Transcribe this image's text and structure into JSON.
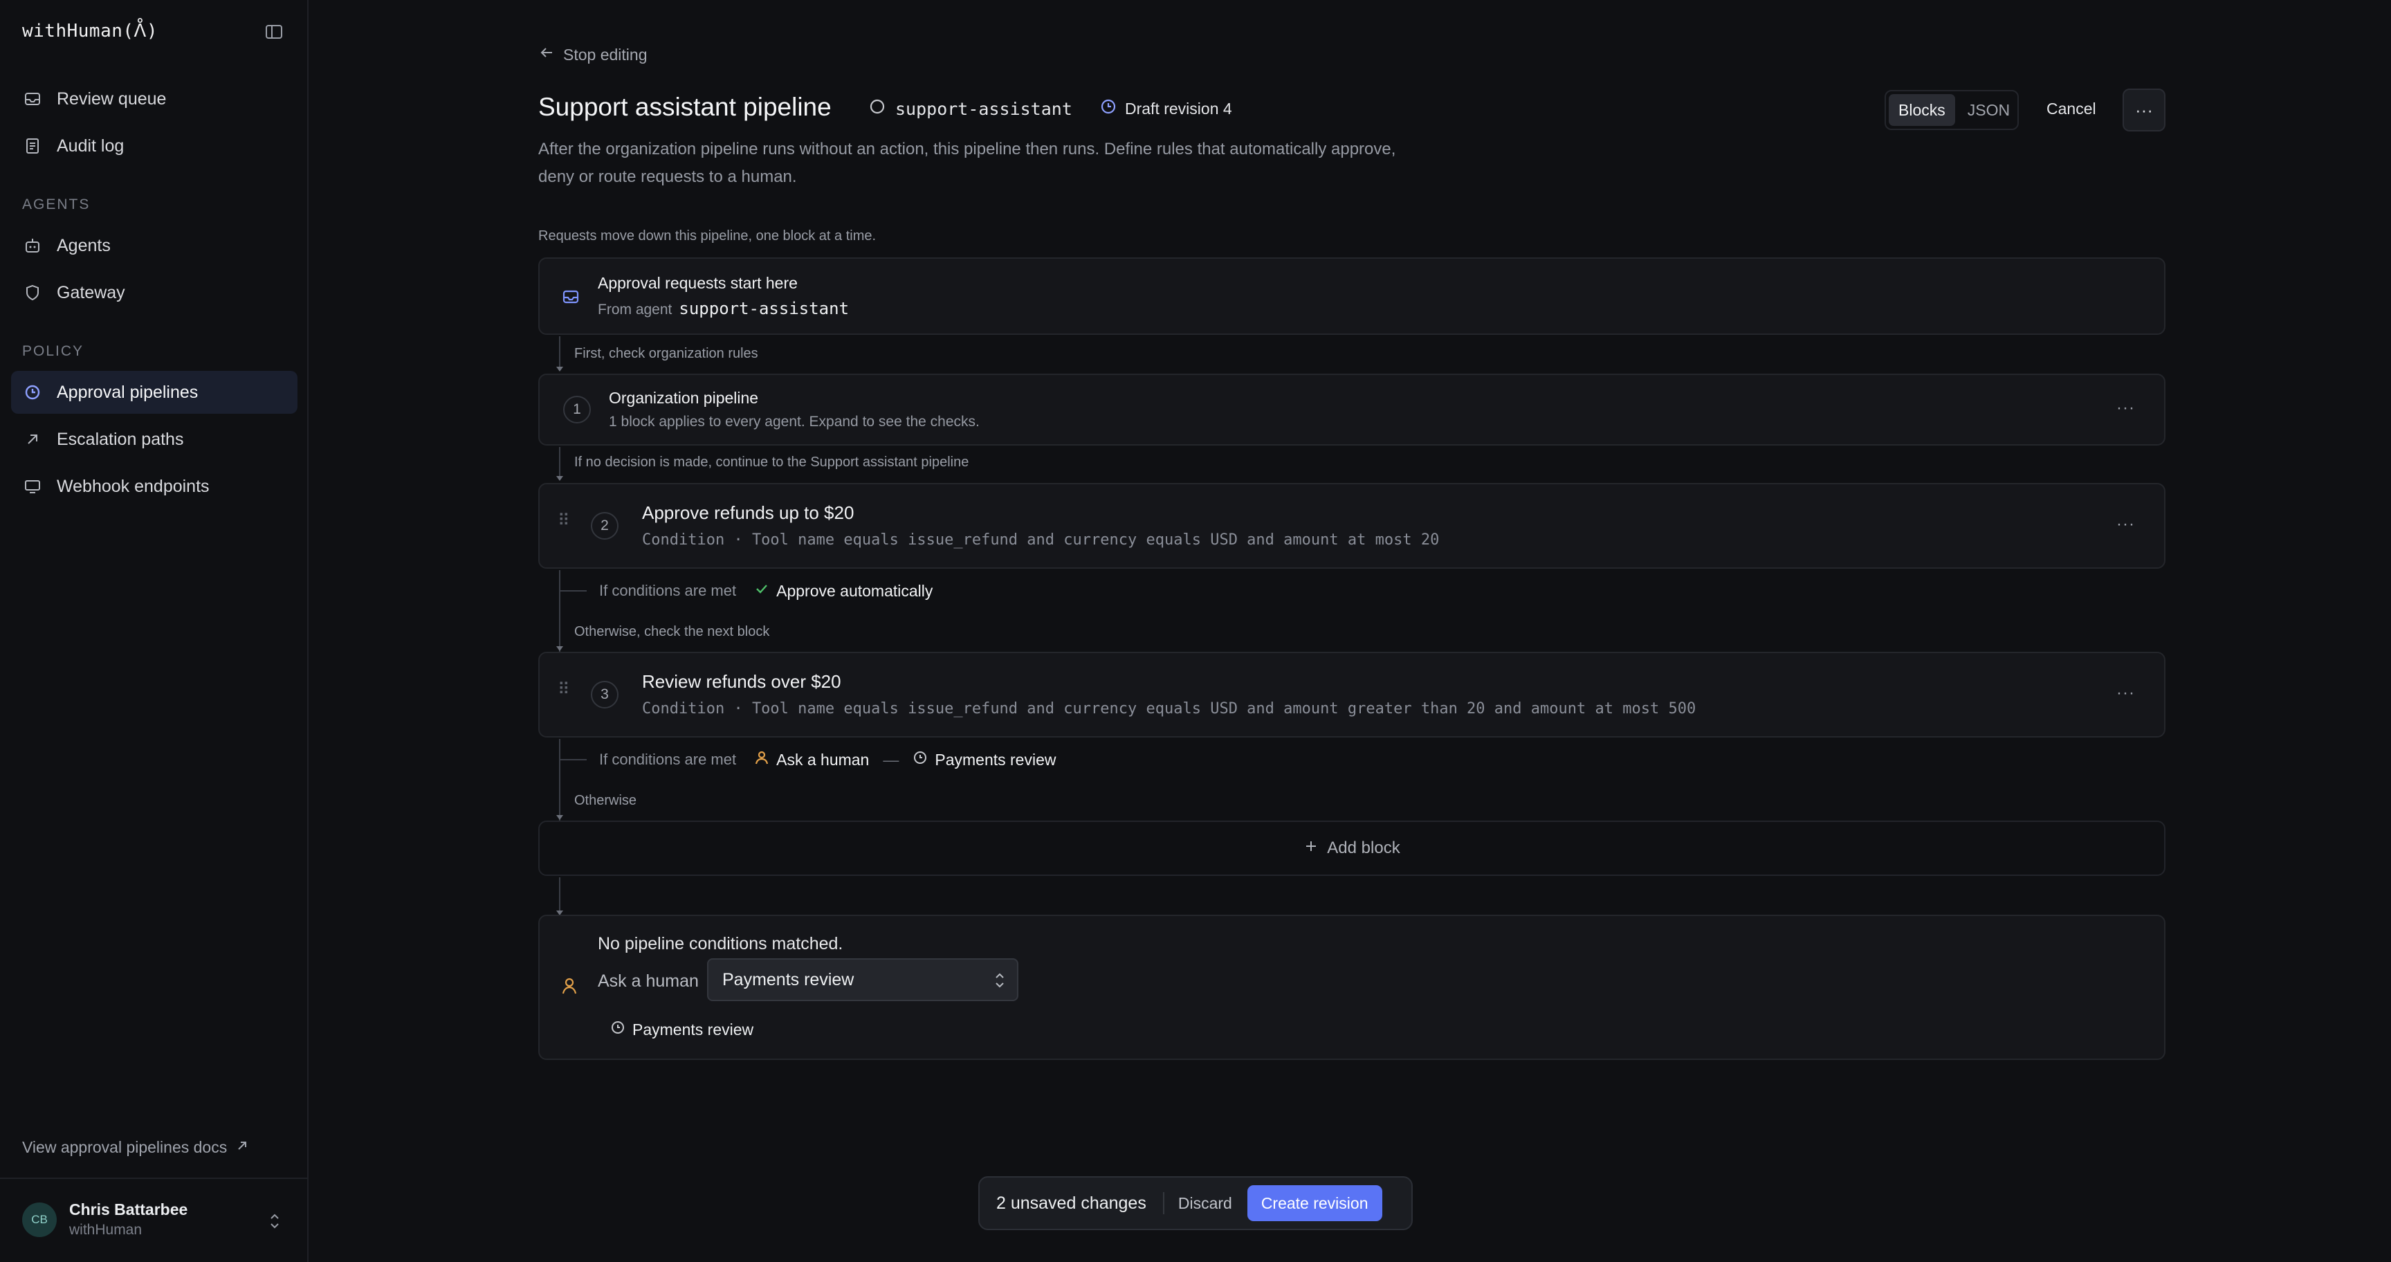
{
  "sidebar": {
    "brand": "withHuman(ᐰ)",
    "top_items": [
      {
        "label": "Review queue",
        "icon": "inbox-icon"
      },
      {
        "label": "Audit log",
        "icon": "document-icon"
      }
    ],
    "agents_label": "AGENTS",
    "agent_items": [
      {
        "label": "Agents",
        "icon": "bot-icon"
      },
      {
        "label": "Gateway",
        "icon": "shield-icon"
      }
    ],
    "policy_label": "POLICY",
    "policy_items": [
      {
        "label": "Approval pipelines",
        "icon": "pipeline-icon",
        "active": true
      },
      {
        "label": "Escalation paths",
        "icon": "arrow-up-right-icon"
      },
      {
        "label": "Webhook endpoints",
        "icon": "monitor-icon"
      }
    ],
    "docs_link": "View approval pipelines docs",
    "user": {
      "initials": "CB",
      "name": "Chris Battarbee",
      "org": "withHuman"
    }
  },
  "header": {
    "back_label": "Stop editing",
    "title": "Support assistant pipeline",
    "slug": "support-assistant",
    "draft": "Draft revision 4",
    "description": "After the organization pipeline runs without an action, this pipeline then runs. Define rules that automatically approve, deny or route requests to a human.",
    "view_modes": [
      "Blocks",
      "JSON"
    ],
    "active_view": "Blocks",
    "cancel_label": "Cancel",
    "more_label": "···"
  },
  "pipeline": {
    "intro": "Requests move down this pipeline, one block at a time.",
    "start": {
      "title": "Approval requests start here",
      "from_label": "From agent",
      "agent": "support-assistant"
    },
    "connector_1": "First, check organization rules",
    "org_block": {
      "number": "1",
      "title": "Organization pipeline",
      "subtitle": "1 block applies to every agent. Expand to see the checks."
    },
    "connector_2": "If no decision is made, continue to the Support assistant pipeline",
    "block_2": {
      "number": "2",
      "title": "Approve refunds up to $20",
      "condition": "Condition · Tool name equals issue_refund and currency equals USD and amount at most 20",
      "result_label": "If conditions are met",
      "result_action": "Approve automatically"
    },
    "connector_3": "Otherwise, check the next block",
    "block_3": {
      "number": "3",
      "title": "Review refunds over $20",
      "condition": "Condition · Tool name equals issue_refund and currency equals USD and amount greater than 20 and amount at most 500",
      "result_label": "If conditions are met",
      "result_action": "Ask a human",
      "result_separator": "—",
      "result_target": "Payments review"
    },
    "connector_4": "Otherwise",
    "add_block": "Add block",
    "fallback": {
      "title": "No pipeline conditions matched.",
      "action_label": "Ask a human",
      "select_value": "Payments review",
      "target": "Payments review"
    }
  },
  "footer_bar": {
    "unsaved": "2 unsaved changes",
    "discard": "Discard",
    "create": "Create revision"
  },
  "colors": {
    "accent": "#5a74f5",
    "approve": "#4fc06a",
    "human": "#e3a14a"
  }
}
